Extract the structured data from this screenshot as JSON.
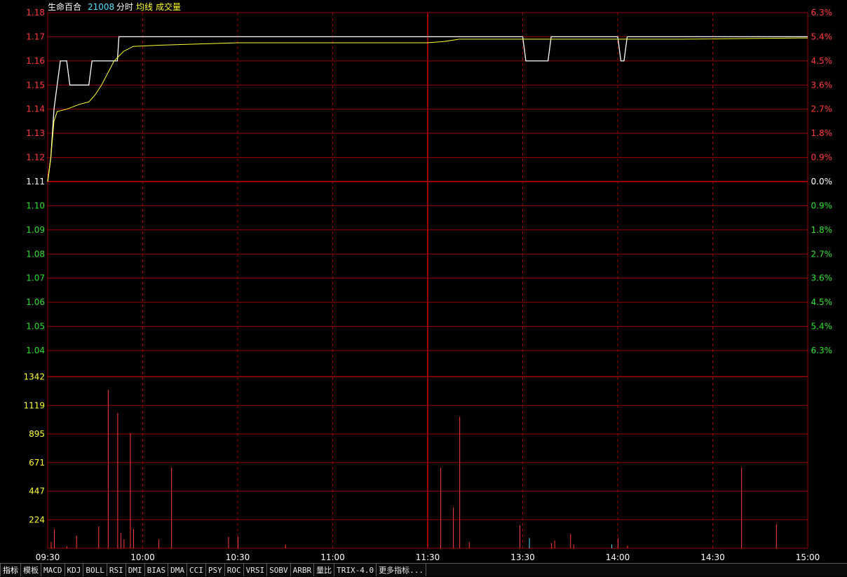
{
  "header": {
    "stock_name": "生命百合",
    "code": "21008",
    "items": [
      "分时",
      "均线",
      "成交量"
    ]
  },
  "colors": {
    "grid": "#9a0000",
    "up_text": "#ff3b3b",
    "down_text": "#2ee02e",
    "neutral_text": "#ffffff",
    "price_line": "#ffffff",
    "avg_line": "#ffff33",
    "volume_bar": "#ff3b3b",
    "volume_bar_down": "#55e0ff",
    "time_label": "#ffffff",
    "volume_axis_text": "#ffff33",
    "code_text": "#55e0ff"
  },
  "chart_data": {
    "type": "line",
    "title": "生命百合 21008 分时",
    "prev_close": 1.11,
    "price_axis": {
      "ticks": [
        "1.18",
        "1.17",
        "1.16",
        "1.15",
        "1.14",
        "1.13",
        "1.12",
        "1.11",
        "1.10",
        "1.09",
        "1.08",
        "1.07",
        "1.06",
        "1.05",
        "1.04"
      ],
      "ylim": [
        1.04,
        1.18
      ]
    },
    "percent_axis": {
      "ticks": [
        "6.3%",
        "5.4%",
        "4.5%",
        "3.6%",
        "2.7%",
        "1.8%",
        "0.9%",
        "0.0%",
        "0.9%",
        "1.8%",
        "2.7%",
        "3.6%",
        "4.5%",
        "5.4%",
        "6.3%"
      ]
    },
    "time_axis": {
      "ticks": [
        "09:30",
        "10:00",
        "10:30",
        "11:00",
        "11:30",
        "13:30",
        "14:00",
        "14:30",
        "15:00"
      ],
      "minutes": [
        0,
        30,
        60,
        90,
        120,
        150,
        180,
        210,
        240
      ]
    },
    "series": [
      {
        "name": "分时",
        "points": [
          [
            0,
            1.11
          ],
          [
            1,
            1.12
          ],
          [
            2,
            1.14
          ],
          [
            3,
            1.15
          ],
          [
            4,
            1.16
          ],
          [
            6,
            1.16
          ],
          [
            7,
            1.15
          ],
          [
            13,
            1.15
          ],
          [
            14,
            1.16
          ],
          [
            22,
            1.16
          ],
          [
            22.5,
            1.17
          ],
          [
            150,
            1.17
          ],
          [
            151,
            1.16
          ],
          [
            158,
            1.16
          ],
          [
            159,
            1.17
          ],
          [
            180,
            1.17
          ],
          [
            181,
            1.16
          ],
          [
            182,
            1.16
          ],
          [
            183,
            1.17
          ],
          [
            240,
            1.17
          ]
        ]
      },
      {
        "name": "均线",
        "points": [
          [
            0,
            1.11
          ],
          [
            1,
            1.12
          ],
          [
            2,
            1.135
          ],
          [
            3,
            1.139
          ],
          [
            6,
            1.14
          ],
          [
            8,
            1.141
          ],
          [
            10,
            1.142
          ],
          [
            13,
            1.143
          ],
          [
            15,
            1.146
          ],
          [
            17,
            1.15
          ],
          [
            19,
            1.155
          ],
          [
            21,
            1.16
          ],
          [
            24,
            1.164
          ],
          [
            27,
            1.166
          ],
          [
            35,
            1.1665
          ],
          [
            60,
            1.1675
          ],
          [
            120,
            1.1675
          ],
          [
            125,
            1.168
          ],
          [
            130,
            1.169
          ],
          [
            150,
            1.169
          ],
          [
            175,
            1.169
          ],
          [
            200,
            1.169
          ],
          [
            240,
            1.1695
          ]
        ]
      }
    ],
    "volume": {
      "ticks": [
        "1342",
        "1119",
        "895",
        "671",
        "447",
        "224"
      ],
      "ylim": [
        0,
        1342
      ],
      "bars": [
        [
          1,
          50,
          "up"
        ],
        [
          2,
          150,
          "up"
        ],
        [
          6,
          15,
          "up"
        ],
        [
          9,
          100,
          "up"
        ],
        [
          16,
          170,
          "up"
        ],
        [
          19,
          1240,
          "up"
        ],
        [
          22,
          1060,
          "up"
        ],
        [
          23,
          120,
          "up"
        ],
        [
          24,
          70,
          "up"
        ],
        [
          26,
          900,
          "up"
        ],
        [
          27,
          150,
          "up"
        ],
        [
          35,
          70,
          "up"
        ],
        [
          39,
          630,
          "up"
        ],
        [
          57,
          90,
          "up"
        ],
        [
          60,
          90,
          "up"
        ],
        [
          75,
          30,
          "up"
        ],
        [
          124,
          630,
          "up"
        ],
        [
          128,
          320,
          "up"
        ],
        [
          130,
          1030,
          "up"
        ],
        [
          133,
          50,
          "up"
        ],
        [
          149,
          180,
          "up"
        ],
        [
          152,
          80,
          "down"
        ],
        [
          159,
          40,
          "up"
        ],
        [
          160,
          60,
          "up"
        ],
        [
          165,
          110,
          "up"
        ],
        [
          166,
          30,
          "up"
        ],
        [
          178,
          30,
          "down"
        ],
        [
          180,
          80,
          "up"
        ],
        [
          183,
          20,
          "up"
        ],
        [
          219,
          630,
          "up"
        ],
        [
          230,
          190,
          "up"
        ]
      ]
    }
  },
  "tabbar": {
    "tabs": [
      "指标",
      "模板",
      "MACD",
      "KDJ",
      "BOLL",
      "RSI",
      "DMI",
      "BIAS",
      "DMA",
      "CCI",
      "PSY",
      "ROC",
      "VRSI",
      "SOBV",
      "ARBR",
      "量比",
      "TRIX-4.0",
      "更多指标..."
    ]
  }
}
